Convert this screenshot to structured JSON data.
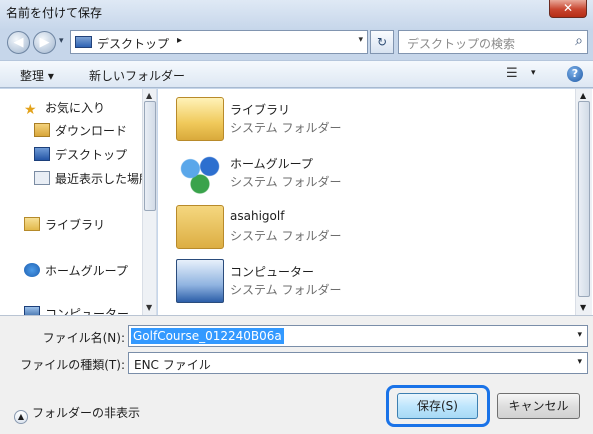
{
  "window": {
    "title": "名前を付けて保存",
    "close_label": "✕"
  },
  "navigation": {
    "back_glyph": "◀",
    "forward_glyph": "▶",
    "history_glyph": "▾",
    "address_text": "デスクトップ",
    "address_separator": "▸",
    "address_dropdown": "▾",
    "refresh_glyph": "↻",
    "search_placeholder": "デスクトップの検索",
    "search_glyph": "⌕"
  },
  "toolbar": {
    "organize_label": "整理 ▾",
    "new_folder_label": "新しいフォルダー",
    "view_glyph": "☰",
    "view_drop": "▾",
    "help_glyph": "?"
  },
  "nav_pane": {
    "items": [
      {
        "label": "お気に入り",
        "icon": "star-icon"
      },
      {
        "label": "ダウンロード",
        "icon": "download-folder-icon"
      },
      {
        "label": "デスクトップ",
        "icon": "desktop-icon"
      },
      {
        "label": "最近表示した場所",
        "icon": "recent-places-icon"
      },
      {
        "label": "ライブラリ",
        "icon": "library-icon"
      },
      {
        "label": "ホームグループ",
        "icon": "homegroup-icon"
      },
      {
        "label": "コンピューター",
        "icon": "computer-icon"
      }
    ]
  },
  "content": {
    "items": [
      {
        "name": "ライブラリ",
        "type": "システム フォルダー",
        "icon": "library-folder-icon"
      },
      {
        "name": "ホームグループ",
        "type": "システム フォルダー",
        "icon": "homegroup-icon"
      },
      {
        "name": "asahigolf",
        "type": "システム フォルダー",
        "icon": "user-folder-icon"
      },
      {
        "name": "コンピューター",
        "type": "システム フォルダー",
        "icon": "computer-icon"
      }
    ]
  },
  "form": {
    "filename_label": "ファイル名(N):",
    "filename_value": "GolfCourse_012240B06a",
    "filetype_label": "ファイルの種類(T):",
    "filetype_value": "ENC ファイル",
    "hide_folders_label": "フォルダーの非表示",
    "save_label": "保存(S)",
    "cancel_label": "キャンセル"
  },
  "colors": {
    "focus_ring": "#1a73e8",
    "selection": "#3399ff"
  }
}
